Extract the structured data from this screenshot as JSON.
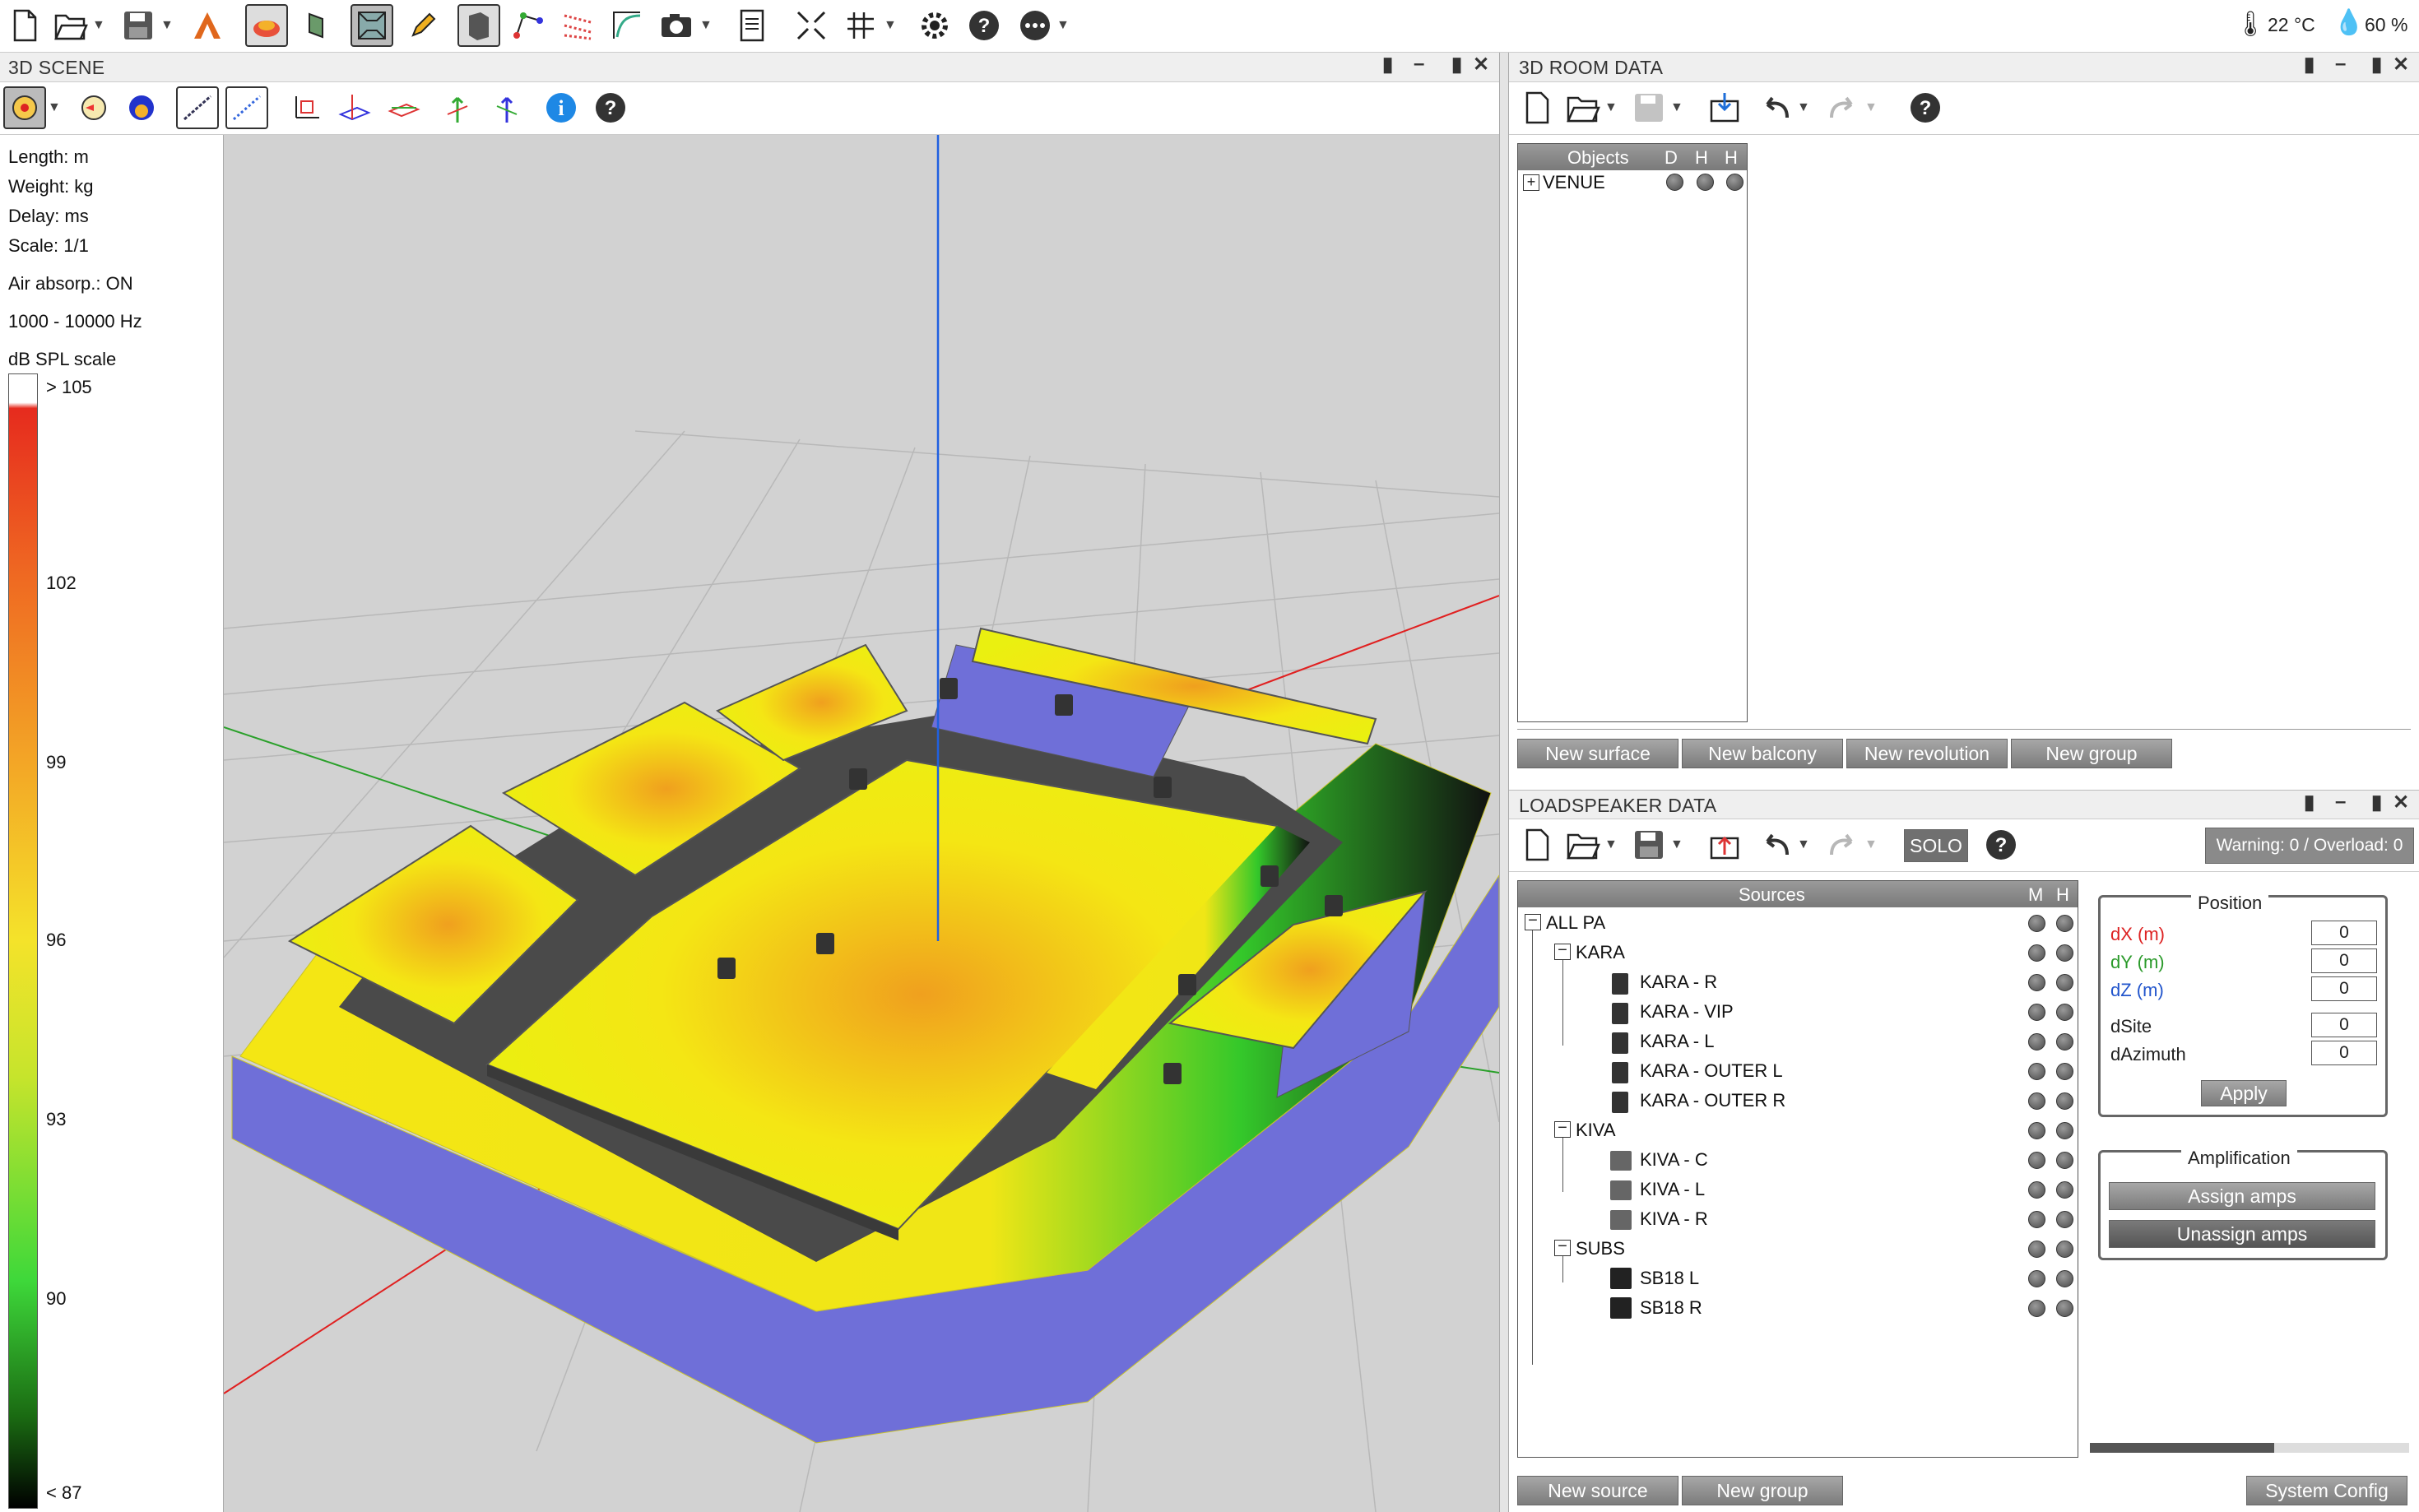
{
  "status": {
    "temperature": "22 °C",
    "humidity": "60 %"
  },
  "toolbar_icons": [
    "new-file",
    "open-folder",
    "save",
    "logo",
    "coverage",
    "wrap",
    "frame-3d",
    "pen",
    "room-box",
    "nodes",
    "scatter",
    "spectrum",
    "camera",
    "report",
    "fit",
    "grid",
    "settings",
    "help",
    "more"
  ],
  "scene": {
    "title": "3D SCENE",
    "info": {
      "length": "Length: m",
      "weight": "Weight: kg",
      "delay": "Delay: ms",
      "scale": "Scale: 1/1",
      "air": "Air absorp.: ON",
      "freq": "1000 - 10000 Hz",
      "spl": "dB SPL scale"
    },
    "scale_ticks": [
      "> 105",
      "102",
      "99",
      "96",
      "93",
      "90",
      "< 87"
    ]
  },
  "room": {
    "title": "3D ROOM DATA",
    "columns": [
      "Objects",
      "D",
      "H",
      "H"
    ],
    "objects": [
      "VENUE"
    ],
    "buttons": {
      "new_surface": "New surface",
      "new_balcony": "New balcony",
      "new_revolution": "New revolution",
      "new_group": "New group"
    }
  },
  "speaker": {
    "title": "LOADSPEAKER DATA",
    "solo": "SOLO",
    "warning": "Warning: 0 / Overload: 0",
    "columns": [
      "Sources",
      "M",
      "H"
    ],
    "tree": [
      "ALL PA",
      "KARA",
      "KARA - R",
      "KARA - VIP",
      "KARA - L",
      "KARA - OUTER L",
      "KARA - OUTER R",
      "KIVA",
      "KIVA - C",
      "KIVA - L",
      "KIVA - R",
      "SUBS",
      "SB18 L",
      "SB18 R"
    ],
    "position": {
      "title": "Position",
      "dx": "dX (m)",
      "dy": "dY (m)",
      "dz": "dZ (m)",
      "dsite": "dSite",
      "dazimuth": "dAzimuth",
      "values": [
        "0",
        "0",
        "0",
        "0",
        "0"
      ],
      "apply": "Apply"
    },
    "amplification": {
      "title": "Amplification",
      "assign": "Assign amps",
      "unassign": "Unassign amps"
    },
    "buttons": {
      "new_source": "New source",
      "new_group": "New group",
      "system_config": "System Config"
    }
  },
  "colors": {
    "surface_blue": "#7070d8",
    "spl_yellow": "#f4ea10",
    "spl_orange": "#f2a11c",
    "spl_green": "#2ec82a",
    "panel_bg": "#ffffff"
  }
}
